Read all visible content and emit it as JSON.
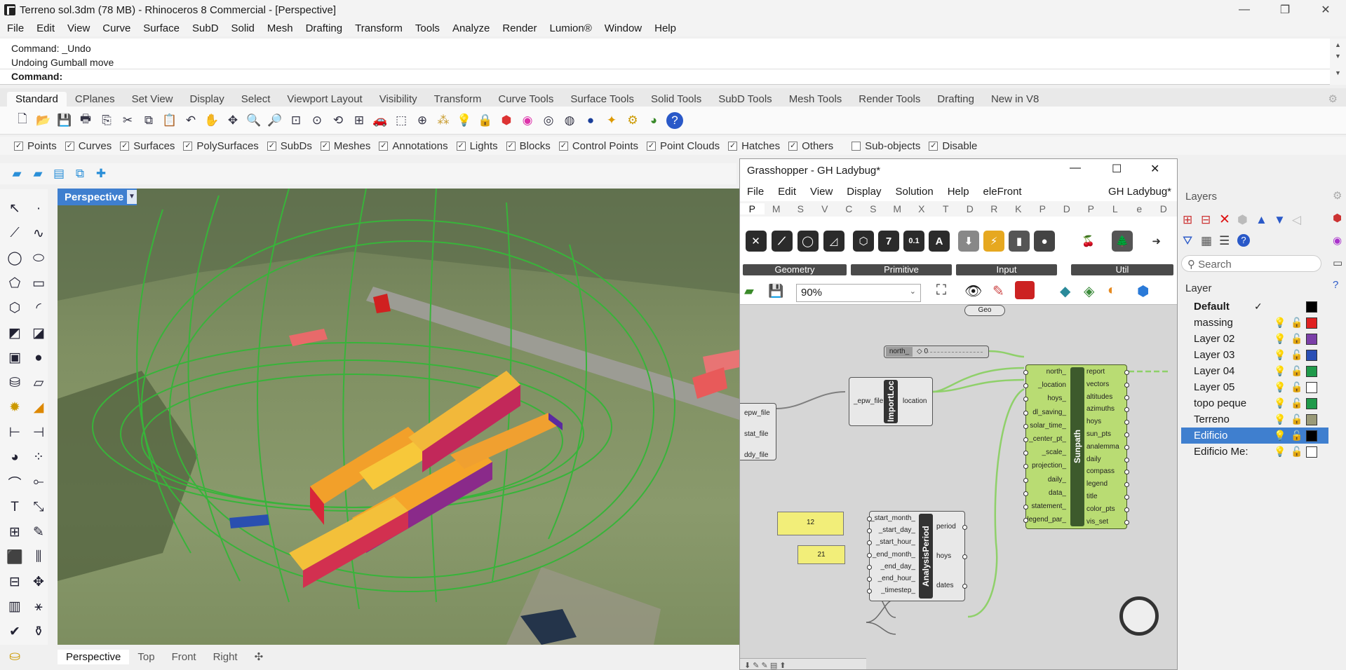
{
  "window": {
    "title": "Terreno sol.3dm (78 MB) - Rhinoceros 8 Commercial - [Perspective]",
    "minimize": "—",
    "maximize": "❐",
    "close": "✕"
  },
  "menu": [
    "File",
    "Edit",
    "View",
    "Curve",
    "Surface",
    "SubD",
    "Solid",
    "Mesh",
    "Drafting",
    "Transform",
    "Tools",
    "Analyze",
    "Render",
    "Lumion®",
    "Window",
    "Help"
  ],
  "command": {
    "history": [
      "Command: _Undo",
      "Undoing Gumball move"
    ],
    "prompt": "Command:"
  },
  "toolbar_tabs": [
    "Standard",
    "CPlanes",
    "Set View",
    "Display",
    "Select",
    "Viewport Layout",
    "Visibility",
    "Transform",
    "Curve Tools",
    "Surface Tools",
    "Solid Tools",
    "SubD Tools",
    "Mesh Tools",
    "Render Tools",
    "Drafting",
    "New in V8"
  ],
  "selection_filters": [
    {
      "label": "Points",
      "checked": true
    },
    {
      "label": "Curves",
      "checked": true
    },
    {
      "label": "Surfaces",
      "checked": true
    },
    {
      "label": "PolySurfaces",
      "checked": true
    },
    {
      "label": "SubDs",
      "checked": true
    },
    {
      "label": "Meshes",
      "checked": true
    },
    {
      "label": "Annotations",
      "checked": true
    },
    {
      "label": "Lights",
      "checked": true
    },
    {
      "label": "Blocks",
      "checked": true
    },
    {
      "label": "Control Points",
      "checked": true
    },
    {
      "label": "Point Clouds",
      "checked": true
    },
    {
      "label": "Hatches",
      "checked": true
    },
    {
      "label": "Others",
      "checked": true
    },
    {
      "label": "Sub-objects",
      "checked": false
    },
    {
      "label": "Disable",
      "checked": true
    }
  ],
  "viewport": {
    "active": "Perspective",
    "dropdown": "▼",
    "tabs": [
      "Perspective",
      "Top",
      "Front",
      "Right"
    ],
    "add_tab": "✣"
  },
  "grasshopper": {
    "title": "Grasshopper - GH Ladybug*",
    "menu": [
      "File",
      "Edit",
      "View",
      "Display",
      "Solution",
      "Help",
      "eleFront"
    ],
    "doc_name": "GH Ladybug*",
    "tabs": [
      "P",
      "M",
      "S",
      "V",
      "C",
      "S",
      "M",
      "X",
      "T",
      "D",
      "R",
      "K",
      "P",
      "D",
      "P",
      "L",
      "e",
      "D"
    ],
    "ribbon_groups": [
      "Geometry",
      "Primitive",
      "Input",
      "Util"
    ],
    "zoom": "90%",
    "components": {
      "geo": "Geo",
      "north_slider": {
        "label": "north_",
        "value": "◇ 0"
      },
      "import": {
        "name": "ImportLoc",
        "input": "_epw_file",
        "output": "location"
      },
      "file_params": [
        "epw_file",
        "stat_file",
        "ddy_file"
      ],
      "sunpath": {
        "name": "Sunpath",
        "inputs": [
          "north_",
          "_location",
          "hoys_",
          "dl_saving_",
          "solar_time_",
          "_center_pt_",
          "_scale_",
          "projection_",
          "daily_",
          "data_",
          "statement_",
          "legend_par_"
        ],
        "outputs": [
          "report",
          "vectors",
          "altitudes",
          "azimuths",
          "hoys",
          "sun_pts",
          "analemma",
          "daily",
          "compass",
          "legend",
          "title",
          "color_pts",
          "vis_set"
        ]
      },
      "analysis": {
        "name": "AnalysisPeriod",
        "inputs": [
          "_start_month_",
          "_start_day_",
          "_start_hour_",
          "_end_month_",
          "_end_day_",
          "_end_hour_",
          "_timestep_"
        ],
        "outputs": [
          "period",
          "hoys",
          "dates"
        ]
      },
      "panels": [
        "12",
        "21"
      ]
    }
  },
  "layers": {
    "title": "Layers",
    "search_placeholder": "Search",
    "column": "Layer",
    "rows": [
      {
        "name": "Default",
        "current": true,
        "color": "#000000"
      },
      {
        "name": "massing",
        "color": "#e02020"
      },
      {
        "name": "Layer 02",
        "color": "#7b3fa8"
      },
      {
        "name": "Layer 03",
        "color": "#2a4fb5"
      },
      {
        "name": "Layer 04",
        "color": "#1f9a4a"
      },
      {
        "name": "Layer 05",
        "color": "#ffffff"
      },
      {
        "name": "topo peque",
        "color": "#1f9a4a"
      },
      {
        "name": "Terreno",
        "color": "#9a9a78"
      },
      {
        "name": "Edificio",
        "color": "#000000",
        "selected": true
      },
      {
        "name": "Edificio Me:",
        "color": "#ffffff"
      }
    ],
    "current_mark": "✓"
  }
}
